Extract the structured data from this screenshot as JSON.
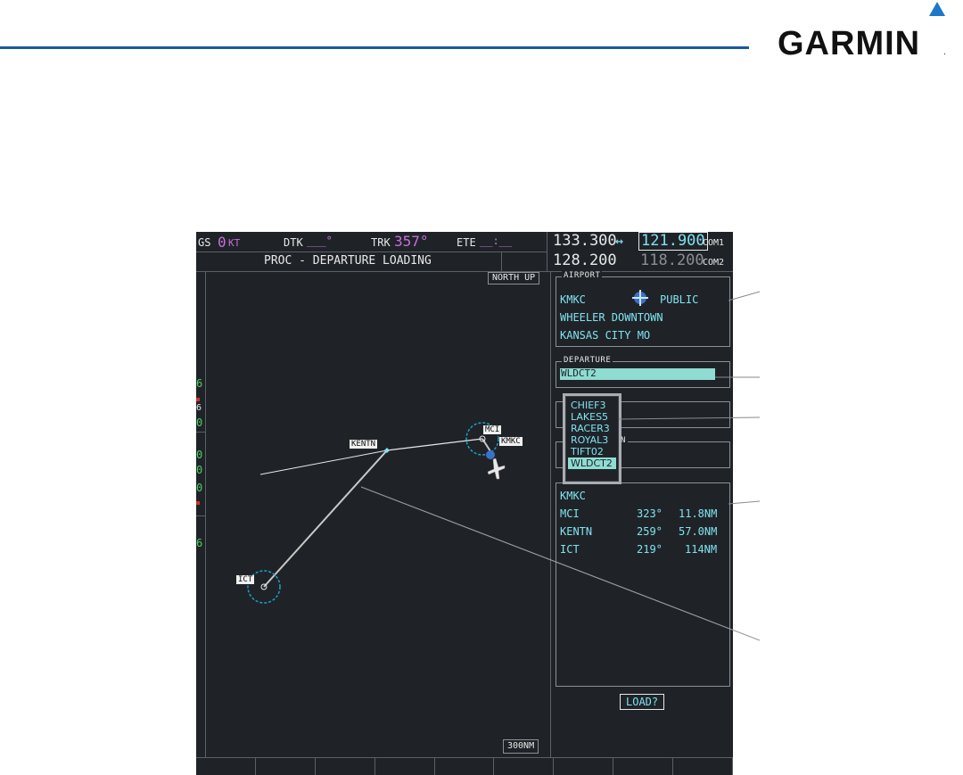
{
  "brand": {
    "logo_text": "GARMIN",
    "logo_mark": "."
  },
  "nav_bar": {
    "gs_label": "GS",
    "gs_value": "0",
    "gs_unit": "KT",
    "dtk_label": "DTK",
    "dtk_value": "___°",
    "trk_label": "TRK",
    "trk_value": "357°",
    "ete_label": "ETE",
    "ete_value": "__:__"
  },
  "com_radios": {
    "com1_active": "133.300",
    "swap_symbol": "↔",
    "com1_standby": "121.900",
    "com1_label": "COM1",
    "com2_active": "128.200",
    "com2_standby": "118.200",
    "com2_label": "COM2"
  },
  "page_title": "PROC - DEPARTURE LOADING",
  "map": {
    "orientation": "NORTH UP",
    "range": "300NM",
    "waypoints": {
      "kentn": "KENTN",
      "mci": "MCI",
      "kmkc": "KMKC",
      "ict": "ICT"
    },
    "left_strip": [
      "6",
      "6",
      "0",
      "0",
      "0",
      "0",
      "6"
    ]
  },
  "airport_box": {
    "title": "AIRPORT",
    "ident": "KMKC",
    "type": "PUBLIC",
    "name": "WHEELER DOWNTOWN",
    "city": "KANSAS CITY MO"
  },
  "departure_box": {
    "title": "DEPARTURE",
    "selected": "WLDCT2"
  },
  "transition_box": {
    "title_tail": "N"
  },
  "departure_list": [
    "CHIEF3",
    "LAKES5",
    "RACER3",
    "ROYAL3",
    "TIFT02",
    "WLDCT2"
  ],
  "sequence": {
    "rows": [
      {
        "ident": "KMKC",
        "course": "",
        "dist": ""
      },
      {
        "ident": "MCI",
        "course": "323°",
        "dist": "11.8NM"
      },
      {
        "ident": "KENTN",
        "course": "259°",
        "dist": "57.0NM"
      },
      {
        "ident": "ICT",
        "course": "219°",
        "dist": "114NM"
      }
    ]
  },
  "load_button": "LOAD?",
  "colors": {
    "accent": "#1a5aa0",
    "cyan": "#7fe3ef",
    "magenta": "#c86fd8",
    "screen_bg": "#1f2328"
  }
}
